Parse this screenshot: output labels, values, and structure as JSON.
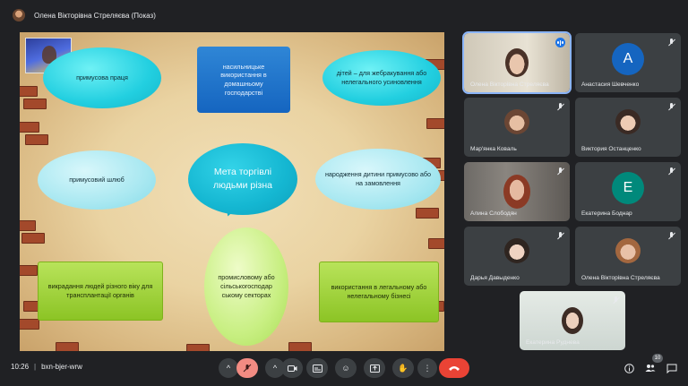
{
  "window": {
    "presenter_title": "Олена Вікторівна Стреляєва (Показ)"
  },
  "slide": {
    "center_bubble": "Мета торгівлі людьми різна",
    "shapes": {
      "forced_labor": "примусова праця",
      "domestic_violence": "насильницьке використання в домашньому господарстві",
      "children_begging": "дітей – для жебракування або нелегального усиновлення",
      "forced_marriage": "примусовий шлюб",
      "child_birth": "народження дитини примусово або на замовлення",
      "organ_trafficking": "викрадання людей різного віку для трансплантації органів",
      "industrial_sector": "промисловому або сільськогосподар ському секторах",
      "business_use": "використання в легальному або нелегальному бізнесі"
    }
  },
  "participants": [
    {
      "name": "Олена Вікторівна Стреляєва",
      "muted": false,
      "speaking": true
    },
    {
      "name": "Анастасия Шевченко",
      "muted": true,
      "avatar_letter": "A",
      "avatar_color": "#1565c0"
    },
    {
      "name": "Мар'янка Коваль",
      "muted": true
    },
    {
      "name": "Виктория Останценко",
      "muted": true
    },
    {
      "name": "Алина Слободян",
      "muted": true
    },
    {
      "name": "Екатерина Боднар",
      "muted": true,
      "avatar_letter": "E",
      "avatar_color": "#00897b"
    },
    {
      "name": "Дарья Давыденко",
      "muted": true
    },
    {
      "name": "Олена Вікторівна Стреляєва",
      "muted": true
    },
    {
      "name": "Екатерина Руднева",
      "muted": true
    }
  ],
  "bottombar": {
    "time": "10:26",
    "meeting_code": "bxn-bjer-wrw",
    "participant_count": "10"
  },
  "colors": {
    "accent": "#8ab4f8",
    "end_call": "#ea4335",
    "mic_muted": "#f28b82",
    "background": "#202124"
  }
}
